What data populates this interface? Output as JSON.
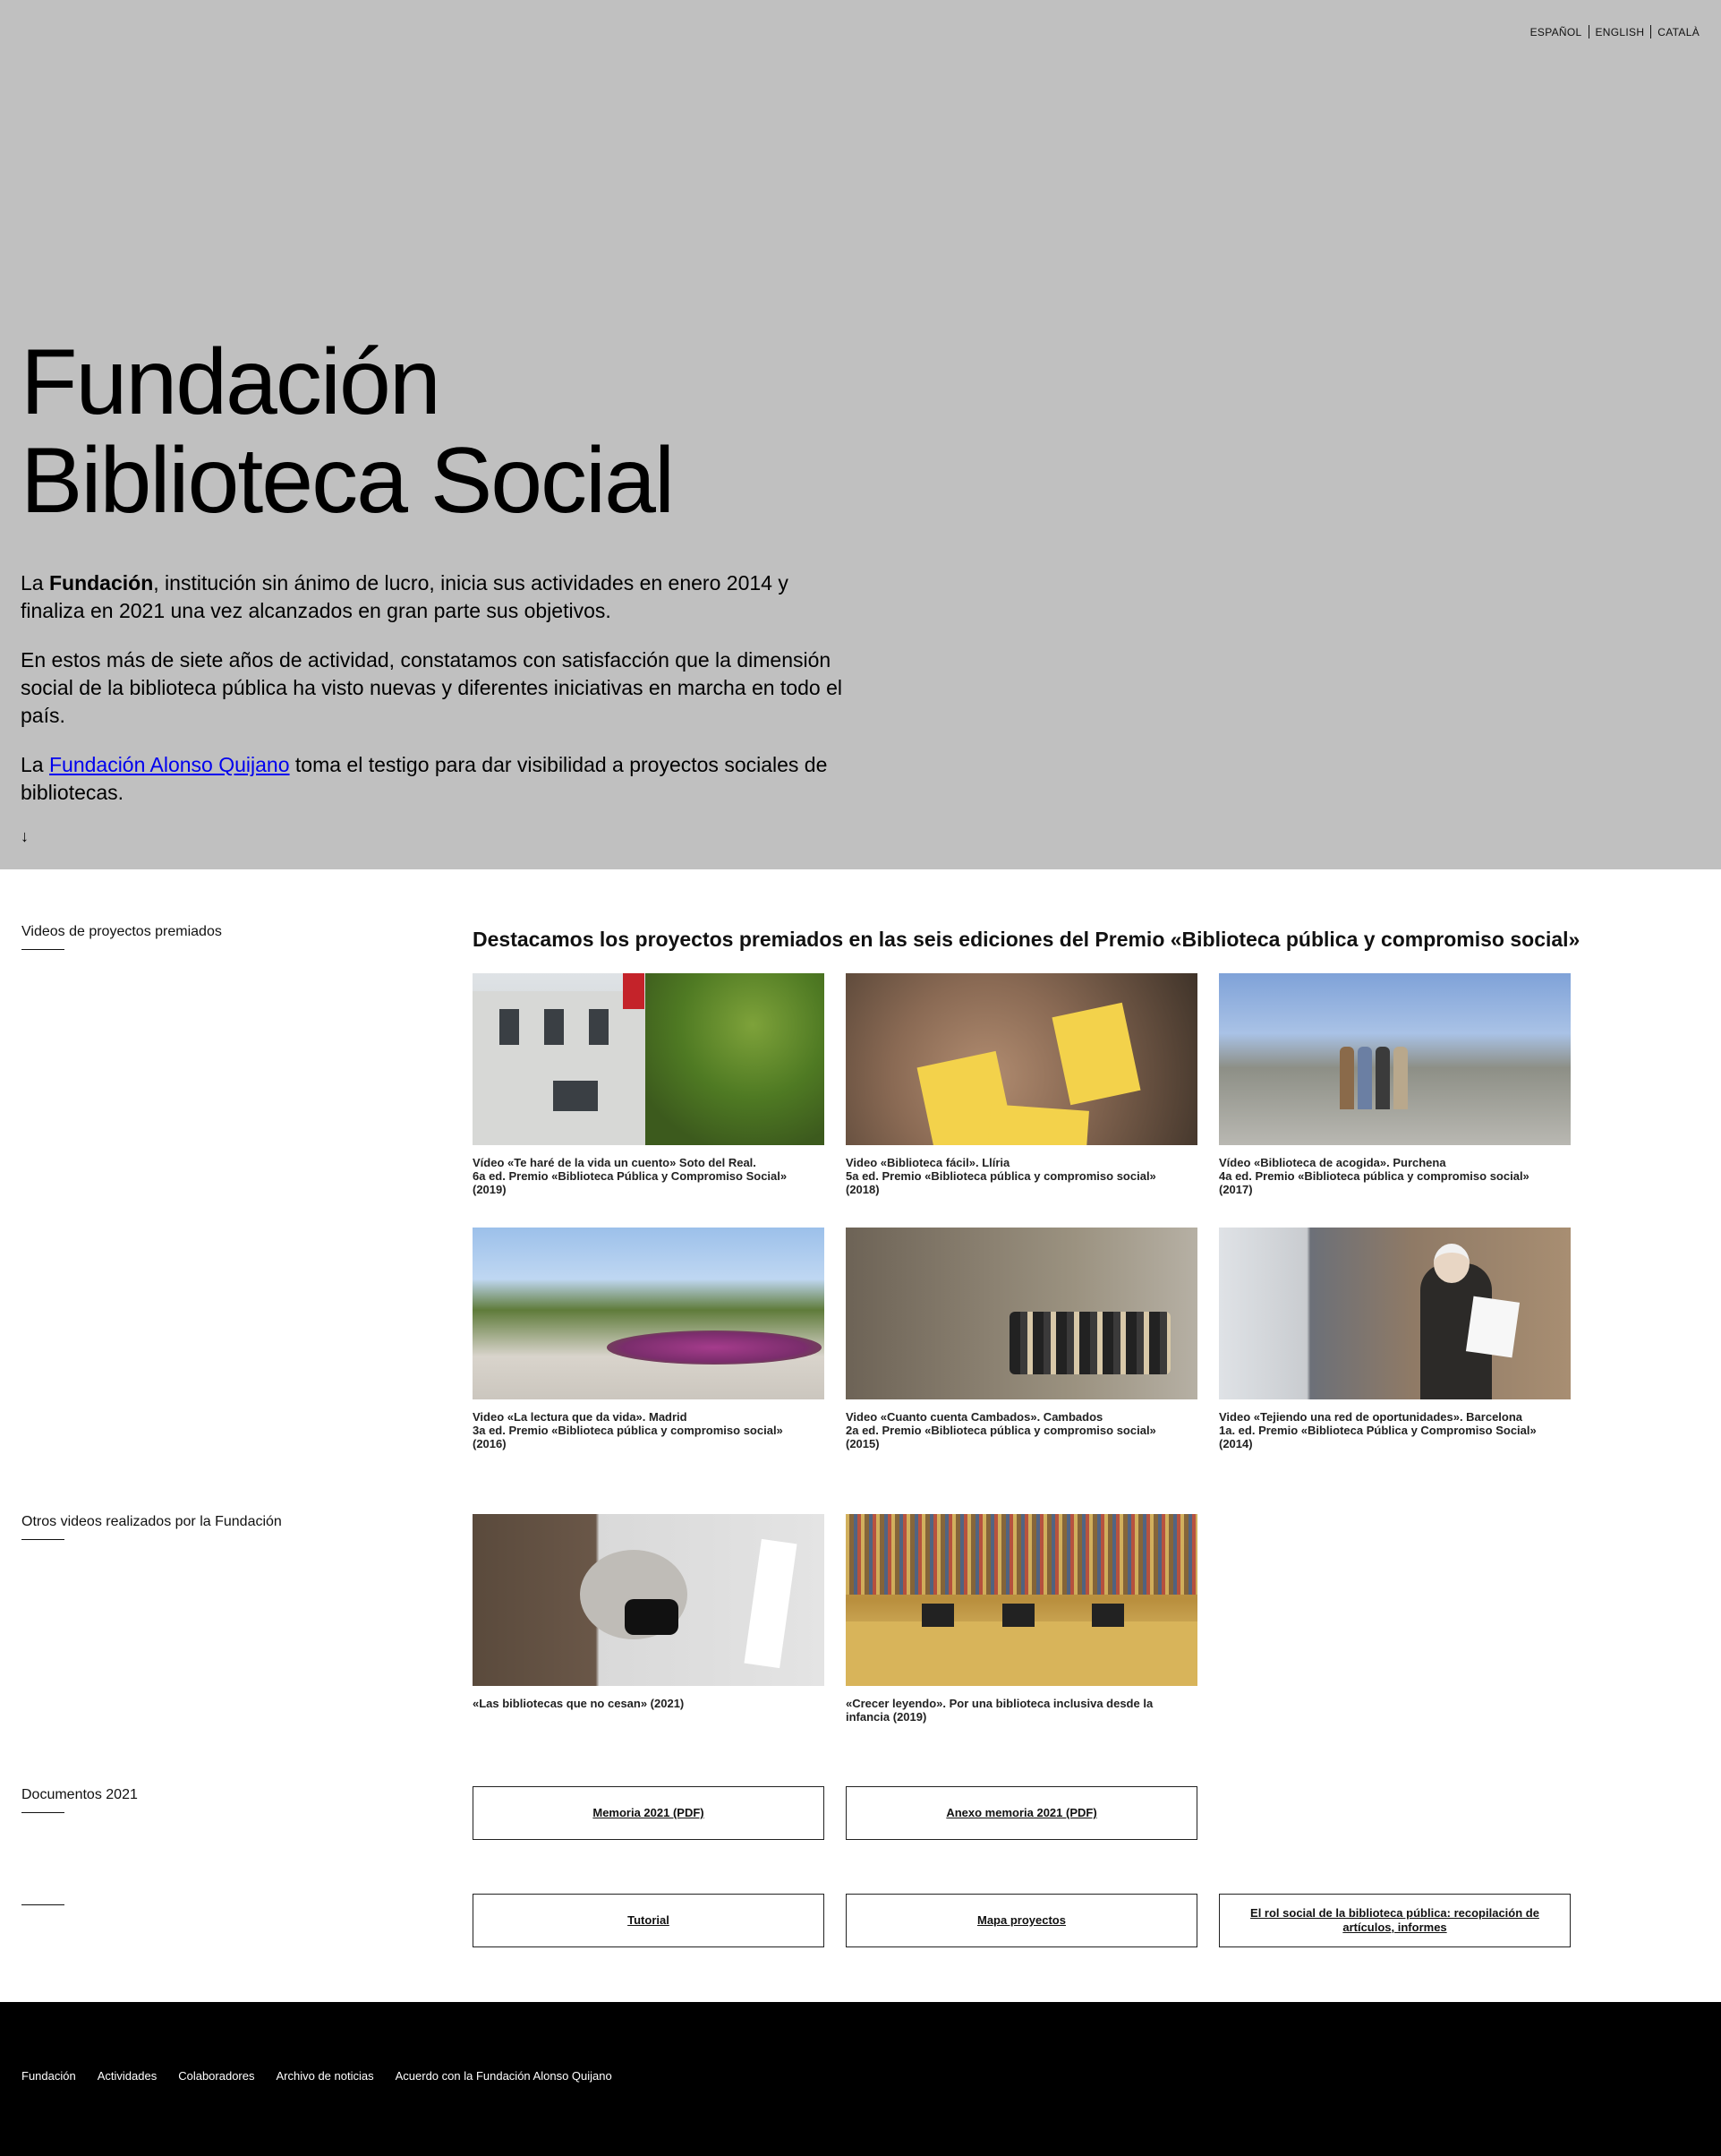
{
  "languages": [
    "ESPAÑOL",
    "ENGLISH",
    "CATALÀ"
  ],
  "hero": {
    "title_line1": "Fundación",
    "title_line2": "Biblioteca Social",
    "p1_prefix": "La ",
    "p1_bold": "Fundación",
    "p1_rest": ", institución sin ánimo de lucro, inicia sus actividades en enero 2014 y finaliza en 2021 una vez alcanzados en gran parte sus objetivos.",
    "p2": "En estos más de siete años de actividad, constatamos con satisfacción que la dimensión social de la biblioteca pública ha visto nuevas y diferentes iniciativas en marcha en todo el país.",
    "p3_prefix": "La ",
    "p3_link": "Fundación Alonso Quijano",
    "p3_rest": " toma el testigo para dar visibilidad a proyectos sociales de bibliotecas.",
    "arrow": "↓"
  },
  "awarded": {
    "label": "Videos de proyectos premiados",
    "lead": "Destacamos los proyectos premiados en las seis ediciones del Premio «Biblioteca pública y compromiso social»",
    "videos": [
      {
        "line1": "Vídeo «Te haré de la vida un cuento» Soto del Real.",
        "line2": "6a ed. Premio «Biblioteca Pública y Compromiso Social»",
        "line3": "(2019)"
      },
      {
        "line1": "Video «Biblioteca fácil». Llíria",
        "line2": "5a ed. Premio «Biblioteca pública y compromiso social»",
        "line3": "(2018)"
      },
      {
        "line1": "Vídeo «Biblioteca de acogida». Purchena",
        "line2": "4a ed. Premio «Biblioteca pública y compromiso social»",
        "line3": "(2017)"
      },
      {
        "line1": "Video «La lectura que da vida». Madrid",
        "line2": "3a ed. Premio «Biblioteca pública y compromiso social»",
        "line3": "(2016)"
      },
      {
        "line1": "Video «Cuanto cuenta Cambados». Cambados",
        "line2": "2a ed. Premio «Biblioteca pública y compromiso social»",
        "line3": "(2015)"
      },
      {
        "line1": "Video «Tejiendo una red de oportunidades». Barcelona",
        "line2": "1a. ed. Premio «Biblioteca Pública y Compromiso Social»",
        "line3": "(2014)"
      }
    ]
  },
  "other": {
    "label": "Otros videos realizados por la Fundación",
    "videos": [
      {
        "caption": "«Las bibliotecas que no cesan» (2021)"
      },
      {
        "caption": "«Crecer leyendo». Por una biblioteca inclusiva desde la infancia (2019)"
      }
    ]
  },
  "documents": {
    "label": "Documentos 2021",
    "buttons": [
      "Memoria 2021 (PDF)",
      "Anexo memoria 2021 (PDF)"
    ]
  },
  "resources": {
    "buttons": [
      "Tutorial",
      "Mapa proyectos",
      "El rol social de la biblioteca pública: recopilación de artículos, informes"
    ]
  },
  "footer": {
    "links": [
      "Fundación",
      "Actividades",
      "Colaboradores",
      "Archivo de noticias",
      "Acuerdo con la Fundación Alonso Quijano"
    ]
  }
}
